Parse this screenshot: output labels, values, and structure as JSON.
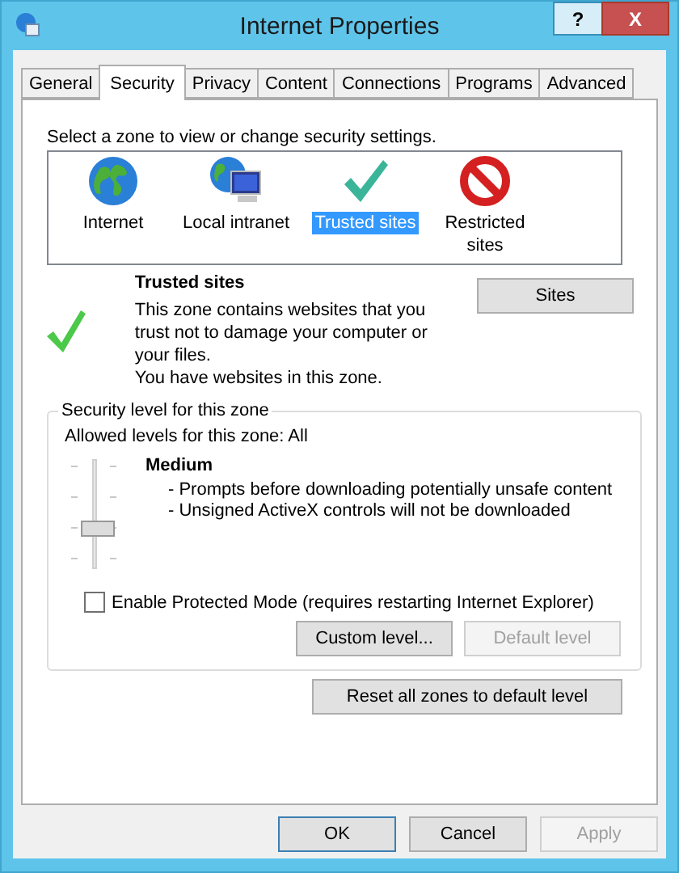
{
  "window": {
    "title": "Internet Properties",
    "controls": [
      "?",
      "X"
    ]
  },
  "tabs": [
    {
      "label": "General",
      "selected": false
    },
    {
      "label": "Security",
      "selected": true
    },
    {
      "label": "Privacy",
      "selected": false
    },
    {
      "label": "Content",
      "selected": false
    },
    {
      "label": "Connections",
      "selected": false
    },
    {
      "label": "Programs",
      "selected": false
    },
    {
      "label": "Advanced",
      "selected": false
    }
  ],
  "prompt": "Select a zone to view or change security settings.",
  "zones": [
    {
      "label": "Internet",
      "kind": "globe",
      "selected": false
    },
    {
      "label": "Local intranet",
      "kind": "intranet",
      "selected": false
    },
    {
      "label": "Trusted sites",
      "kind": "trusted",
      "selected": true
    },
    {
      "label": "Restricted sites",
      "kind": "restricted",
      "selected": false
    }
  ],
  "zone_info": {
    "title": "Trusted sites",
    "lines": [
      "This zone contains websites that you trust not to damage your computer or your files.",
      "You have websites in this zone."
    ],
    "button": "Sites"
  },
  "security_level": {
    "legend": "Security level for this zone",
    "allowed": "Allowed levels for this zone: All",
    "level": 0.333,
    "level_name": "Medium",
    "bullets": [
      "- Prompts before downloading potentially unsafe content",
      "- Unsigned ActiveX controls will not be downloaded"
    ],
    "protected_mode": {
      "label": "Enable Protected Mode (requires restarting Internet Explorer)",
      "checked": false
    },
    "buttons": [
      {
        "label": "Custom level...",
        "disabled": false
      },
      {
        "label": "Default level",
        "disabled": true
      }
    ]
  },
  "reset_button": {
    "label": "Reset all zones to default level",
    "disabled": false
  },
  "dialog_buttons": [
    {
      "label": "OK",
      "disabled": false,
      "default": true
    },
    {
      "label": "Cancel",
      "disabled": false,
      "default": false
    },
    {
      "label": "Apply",
      "disabled": true,
      "default": false
    }
  ]
}
